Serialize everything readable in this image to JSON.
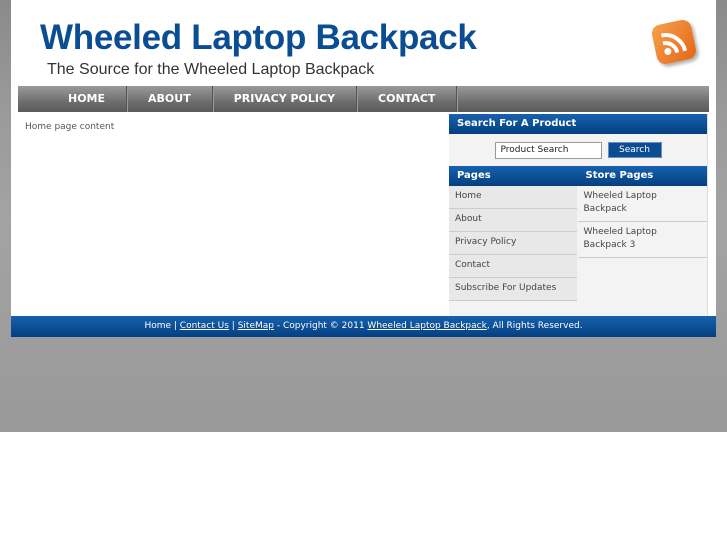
{
  "header": {
    "title": "Wheeled Laptop Backpack",
    "tagline": "The Source for the Wheeled Laptop Backpack",
    "rss_icon": "rss-icon"
  },
  "nav": [
    "HOME",
    "ABOUT",
    "PRIVACY POLICY",
    "CONTACT"
  ],
  "main": {
    "content": "Home page content"
  },
  "sidebar": {
    "search_title": "Search For A Product",
    "search_value": "Product Search",
    "search_button": "Search",
    "pages_title": "Pages",
    "pages": [
      "Home",
      "About",
      "Privacy Policy",
      "Contact",
      "Subscribe For Updates"
    ],
    "store_title": "Store Pages",
    "store": [
      "Wheeled Laptop Backpack",
      "Wheeled Laptop Backpack 3"
    ]
  },
  "footer": {
    "home": "Home",
    "sep1": " | ",
    "contact": "Contact Us",
    "sep2": " | ",
    "sitemap": "SiteMap",
    "copy": " - Copyright © 2011 ",
    "site": "Wheeled Laptop Backpack",
    "rights": ", All Rights Reserved."
  },
  "colors": {
    "brand": "#0b4d92",
    "rss": "#e4661a"
  }
}
